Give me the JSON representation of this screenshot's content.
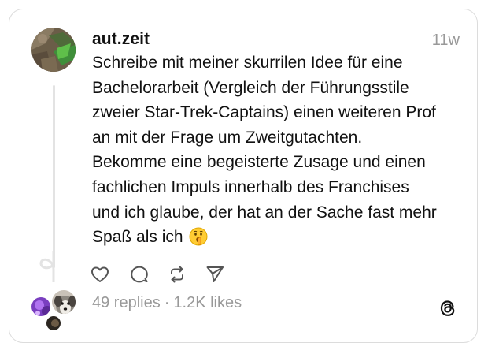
{
  "post": {
    "username": "aut.zeit",
    "timestamp": "11w",
    "text": "Schreibe mit meiner skurrilen Idee für eine\nBachelorarbeit (Vergleich der Führungsstile\nzweier Star-Trek-Captains) einen weiteren Prof\nan mit der Frage um Zweitgutachten.\nBekomme eine begeisterte Zusage und einen\nfachlichen Impuls innerhalb des Franchises\nund ich glaube, der hat an der Sache fast mehr\nSpaß als ich",
    "emoji_icon": "shushing-face-emoji-icon"
  },
  "stats": {
    "replies": "49 replies",
    "separator": "·",
    "likes": "1.2K likes"
  },
  "icons": {
    "like": "heart-icon",
    "reply": "comment-icon",
    "repost": "repost-icon",
    "share": "send-icon",
    "brand": "threads-logo-icon"
  },
  "colors": {
    "text": "#111111",
    "muted": "#999999",
    "border": "#dcdcdc",
    "icon": "#555555"
  }
}
